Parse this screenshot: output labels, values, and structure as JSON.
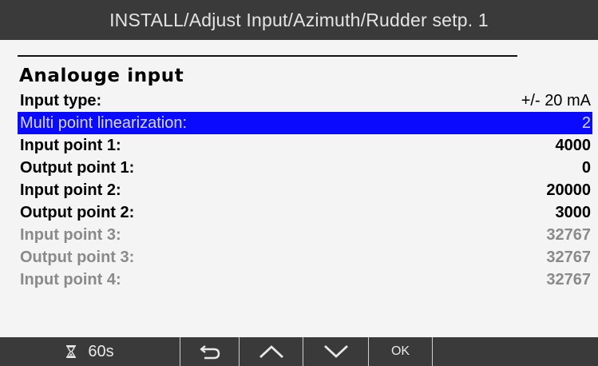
{
  "header": {
    "title": "INSTALL/Adjust Input/Azimuth/Rudder setp. 1"
  },
  "section": {
    "heading": "Analouge input"
  },
  "rows": [
    {
      "label": "Input type:",
      "value": "+/- 20 mA"
    },
    {
      "label": "Multi point linearization:",
      "value": "2"
    },
    {
      "label": "Input point 1:",
      "value": "4000"
    },
    {
      "label": "Output point 1:",
      "value": "0"
    },
    {
      "label": "Input point 2:",
      "value": "20000"
    },
    {
      "label": "Output point 2:",
      "value": "3000"
    },
    {
      "label": "Input point 3:",
      "value": "32767"
    },
    {
      "label": "Output point 3:",
      "value": "32767"
    },
    {
      "label": "Input point 4:",
      "value": "32767"
    }
  ],
  "footer": {
    "timer_icon": "hourglass-icon",
    "timer": "60s",
    "back_icon": "back-arrow-icon",
    "up_icon": "chevron-up-icon",
    "down_icon": "chevron-down-icon",
    "ok_label": "OK"
  },
  "colors": {
    "selected_bg": "#0a0aff",
    "bar_bg": "#3a3a3a",
    "disabled_text": "#8a8a8a"
  }
}
